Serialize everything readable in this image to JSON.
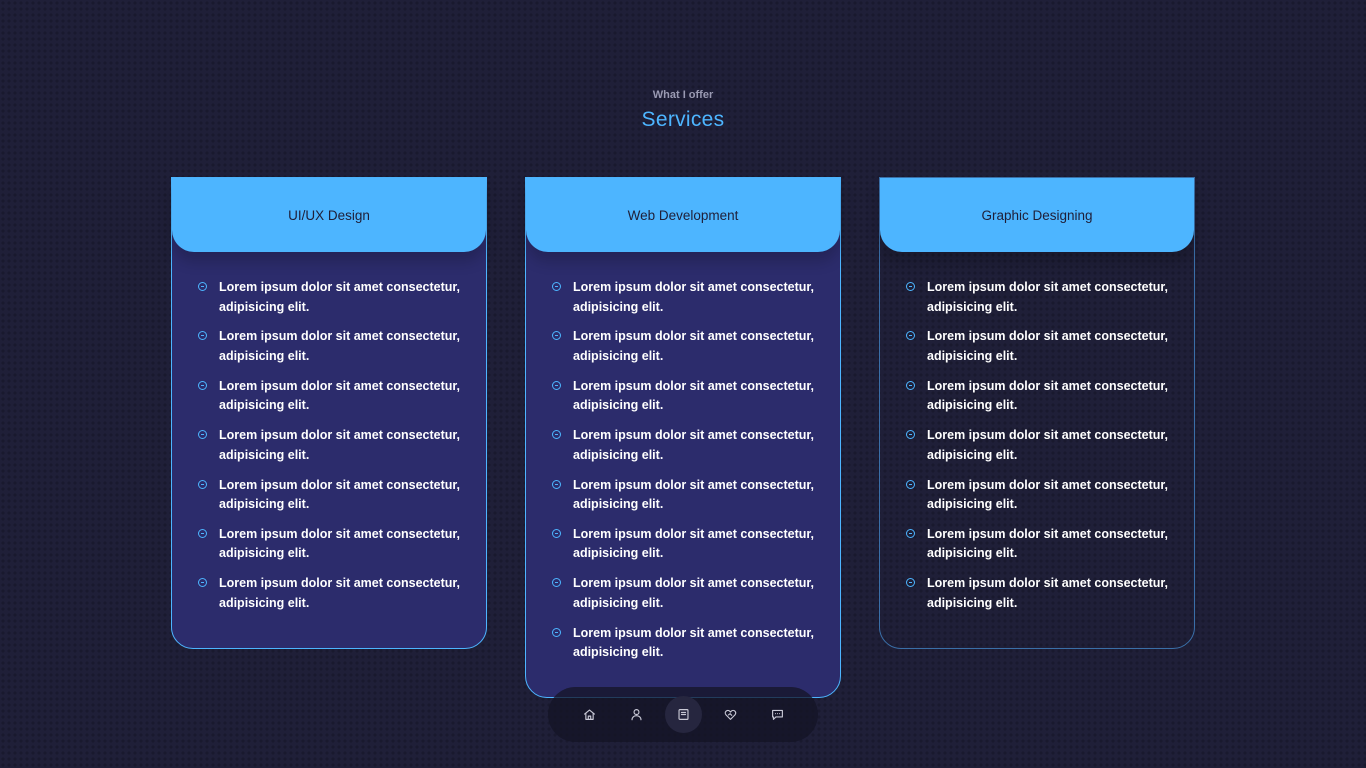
{
  "header": {
    "subtitle": "What I offer",
    "title": "Services"
  },
  "colors": {
    "accent": "#4db5ff",
    "background": "#1f1f38",
    "card_fill": "#2c2c6c"
  },
  "services": [
    {
      "title": "UI/UX Design",
      "items": [
        "Lorem ipsum dolor sit amet consectetur, adipisicing elit.",
        "Lorem ipsum dolor sit amet consectetur, adipisicing elit.",
        "Lorem ipsum dolor sit amet consectetur, adipisicing elit.",
        "Lorem ipsum dolor sit amet consectetur, adipisicing elit.",
        "Lorem ipsum dolor sit amet consectetur, adipisicing elit.",
        "Lorem ipsum dolor sit amet consectetur, adipisicing elit.",
        "Lorem ipsum dolor sit amet consectetur, adipisicing elit."
      ]
    },
    {
      "title": "Web Development",
      "items": [
        "Lorem ipsum dolor sit amet consectetur, adipisicing elit.",
        "Lorem ipsum dolor sit amet consectetur, adipisicing elit.",
        "Lorem ipsum dolor sit amet consectetur, adipisicing elit.",
        "Lorem ipsum dolor sit amet consectetur, adipisicing elit.",
        "Lorem ipsum dolor sit amet consectetur, adipisicing elit.",
        "Lorem ipsum dolor sit amet consectetur, adipisicing elit.",
        "Lorem ipsum dolor sit amet consectetur, adipisicing elit.",
        "Lorem ipsum dolor sit amet consectetur, adipisicing elit."
      ]
    },
    {
      "title": "Graphic Designing",
      "items": [
        "Lorem ipsum dolor sit amet consectetur, adipisicing elit.",
        "Lorem ipsum dolor sit amet consectetur, adipisicing elit.",
        "Lorem ipsum dolor sit amet consectetur, adipisicing elit.",
        "Lorem ipsum dolor sit amet consectetur, adipisicing elit.",
        "Lorem ipsum dolor sit amet consectetur, adipisicing elit.",
        "Lorem ipsum dolor sit amet consectetur, adipisicing elit.",
        "Lorem ipsum dolor sit amet consectetur, adipisicing elit."
      ]
    }
  ],
  "nav": {
    "items": [
      {
        "icon": "home-icon",
        "active": false
      },
      {
        "icon": "user-icon",
        "active": false
      },
      {
        "icon": "book-icon",
        "active": true
      },
      {
        "icon": "heart-handshake-icon",
        "active": false
      },
      {
        "icon": "message-icon",
        "active": false
      }
    ]
  }
}
